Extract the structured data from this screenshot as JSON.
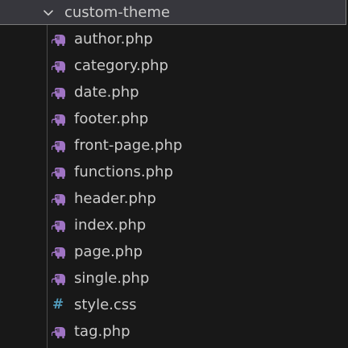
{
  "explorer": {
    "folder": {
      "name": "custom-theme",
      "expanded_icon": "chevron-down-icon"
    },
    "files": [
      {
        "name": "author.php",
        "icon": "php-elephant-icon",
        "icon_color": "#a074c4"
      },
      {
        "name": "category.php",
        "icon": "php-elephant-icon",
        "icon_color": "#a074c4"
      },
      {
        "name": "date.php",
        "icon": "php-elephant-icon",
        "icon_color": "#a074c4"
      },
      {
        "name": "footer.php",
        "icon": "php-elephant-icon",
        "icon_color": "#a074c4"
      },
      {
        "name": "front-page.php",
        "icon": "php-elephant-icon",
        "icon_color": "#a074c4"
      },
      {
        "name": "functions.php",
        "icon": "php-elephant-icon",
        "icon_color": "#a074c4"
      },
      {
        "name": "header.php",
        "icon": "php-elephant-icon",
        "icon_color": "#a074c4"
      },
      {
        "name": "index.php",
        "icon": "php-elephant-icon",
        "icon_color": "#a074c4"
      },
      {
        "name": "page.php",
        "icon": "php-elephant-icon",
        "icon_color": "#a074c4"
      },
      {
        "name": "single.php",
        "icon": "php-elephant-icon",
        "icon_color": "#a074c4"
      },
      {
        "name": "style.css",
        "icon": "css-hash-icon",
        "icon_color": "#519aba",
        "glyph": "#"
      },
      {
        "name": "tag.php",
        "icon": "php-elephant-icon",
        "icon_color": "#a074c4"
      }
    ]
  },
  "colors": {
    "background": "#181818",
    "folder_row_background": "#37373d",
    "text": "#cccccc",
    "php_icon": "#a074c4",
    "css_icon": "#519aba"
  }
}
